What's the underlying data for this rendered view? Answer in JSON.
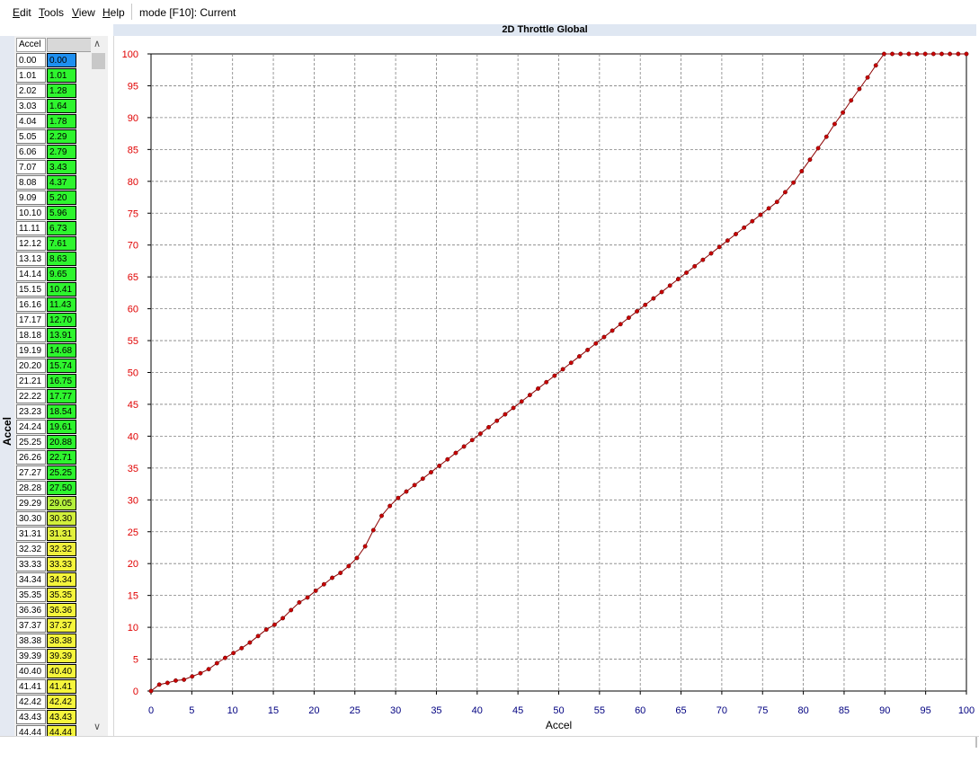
{
  "menu": {
    "items": [
      {
        "first": "E",
        "rest": "dit"
      },
      {
        "first": "T",
        "rest": "ools"
      },
      {
        "first": "V",
        "rest": "iew"
      },
      {
        "first": "H",
        "rest": "elp"
      }
    ],
    "mode_text": "mode [F10]: Current"
  },
  "side_label": "Accel",
  "table": {
    "header": "Accel",
    "rows": [
      {
        "k": "0.00",
        "v": "0.00",
        "color": "#1e8ff0"
      },
      {
        "k": "1.01",
        "v": "1.01",
        "color": "#2ef52e"
      },
      {
        "k": "2.02",
        "v": "1.28",
        "color": "#2ef52e"
      },
      {
        "k": "3.03",
        "v": "1.64",
        "color": "#2ef52e"
      },
      {
        "k": "4.04",
        "v": "1.78",
        "color": "#2ef52e"
      },
      {
        "k": "5.05",
        "v": "2.29",
        "color": "#2ef52e"
      },
      {
        "k": "6.06",
        "v": "2.79",
        "color": "#2ef52e"
      },
      {
        "k": "7.07",
        "v": "3.43",
        "color": "#2ef52e"
      },
      {
        "k": "8.08",
        "v": "4.37",
        "color": "#2ef52e"
      },
      {
        "k": "9.09",
        "v": "5.20",
        "color": "#2ef52e"
      },
      {
        "k": "10.10",
        "v": "5.96",
        "color": "#2ef52e"
      },
      {
        "k": "11.11",
        "v": "6.73",
        "color": "#2ef52e"
      },
      {
        "k": "12.12",
        "v": "7.61",
        "color": "#2ef52e"
      },
      {
        "k": "13.13",
        "v": "8.63",
        "color": "#2ef52e"
      },
      {
        "k": "14.14",
        "v": "9.65",
        "color": "#2ef52e"
      },
      {
        "k": "15.15",
        "v": "10.41",
        "color": "#2ef52e"
      },
      {
        "k": "16.16",
        "v": "11.43",
        "color": "#2ef52e"
      },
      {
        "k": "17.17",
        "v": "12.70",
        "color": "#2ef52e"
      },
      {
        "k": "18.18",
        "v": "13.91",
        "color": "#2ef52e"
      },
      {
        "k": "19.19",
        "v": "14.68",
        "color": "#2ef52e"
      },
      {
        "k": "20.20",
        "v": "15.74",
        "color": "#2ef52e"
      },
      {
        "k": "21.21",
        "v": "16.75",
        "color": "#2ef52e"
      },
      {
        "k": "22.22",
        "v": "17.77",
        "color": "#2ef52e"
      },
      {
        "k": "23.23",
        "v": "18.54",
        "color": "#2ef52e"
      },
      {
        "k": "24.24",
        "v": "19.61",
        "color": "#2ef52e"
      },
      {
        "k": "25.25",
        "v": "20.88",
        "color": "#2ef52e"
      },
      {
        "k": "26.26",
        "v": "22.71",
        "color": "#2ef52e"
      },
      {
        "k": "27.27",
        "v": "25.25",
        "color": "#2ef52e"
      },
      {
        "k": "28.28",
        "v": "27.50",
        "color": "#2ef52e"
      },
      {
        "k": "29.29",
        "v": "29.05",
        "color": "#b4f03c"
      },
      {
        "k": "30.30",
        "v": "30.30",
        "color": "#d2f03c"
      },
      {
        "k": "31.31",
        "v": "31.31",
        "color": "#e1f03c"
      },
      {
        "k": "32.32",
        "v": "32.32",
        "color": "#f0f03c"
      },
      {
        "k": "33.33",
        "v": "33.33",
        "color": "#f5f53c"
      },
      {
        "k": "34.34",
        "v": "34.34",
        "color": "#f5f53c"
      },
      {
        "k": "35.35",
        "v": "35.35",
        "color": "#f5f53c"
      },
      {
        "k": "36.36",
        "v": "36.36",
        "color": "#f5f53c"
      },
      {
        "k": "37.37",
        "v": "37.37",
        "color": "#f5f53c"
      },
      {
        "k": "38.38",
        "v": "38.38",
        "color": "#f5f53c"
      },
      {
        "k": "39.39",
        "v": "39.39",
        "color": "#f5f53c"
      },
      {
        "k": "40.40",
        "v": "40.40",
        "color": "#f5f53c"
      },
      {
        "k": "41.41",
        "v": "41.41",
        "color": "#f5f53c"
      },
      {
        "k": "42.42",
        "v": "42.42",
        "color": "#f5f53c"
      },
      {
        "k": "43.43",
        "v": "43.43",
        "color": "#f5f53c"
      },
      {
        "k": "44.44",
        "v": "44.44",
        "color": "#f5f53c"
      }
    ]
  },
  "chart_data": {
    "type": "line",
    "title": "2D Throttle Global",
    "xlabel": "Accel",
    "ylabel": "",
    "xlim": [
      0,
      100
    ],
    "ylim": [
      0,
      100
    ],
    "xticks": [
      0,
      5,
      10,
      15,
      20,
      25,
      30,
      35,
      40,
      45,
      50,
      55,
      60,
      65,
      70,
      75,
      80,
      85,
      90,
      95,
      100
    ],
    "yticks": [
      0,
      5,
      10,
      15,
      20,
      25,
      30,
      35,
      40,
      45,
      50,
      55,
      60,
      65,
      70,
      75,
      80,
      85,
      90,
      95,
      100
    ],
    "grid": true,
    "colors": {
      "line": "#8b0000",
      "marker": "#c80000",
      "ytick": "#e00000",
      "xtick": "#000080",
      "grid": "#808080"
    },
    "x": [
      0,
      1.01,
      2.02,
      3.03,
      4.04,
      5.05,
      6.06,
      7.07,
      8.08,
      9.09,
      10.1,
      11.11,
      12.12,
      13.13,
      14.14,
      15.15,
      16.16,
      17.17,
      18.18,
      19.19,
      20.2,
      21.21,
      22.22,
      23.23,
      24.24,
      25.25,
      26.26,
      27.27,
      28.28,
      29.29,
      30.3,
      31.31,
      32.32,
      33.33,
      34.34,
      35.35,
      36.36,
      37.37,
      38.38,
      39.39,
      40.4,
      41.41,
      42.42,
      43.43,
      44.44,
      45.45,
      46.46,
      47.47,
      48.48,
      49.49,
      50.51,
      51.52,
      52.53,
      53.54,
      54.55,
      55.56,
      56.57,
      57.58,
      58.59,
      59.6,
      60.61,
      61.62,
      62.63,
      63.64,
      64.65,
      65.66,
      66.67,
      67.68,
      68.69,
      69.7,
      70.71,
      71.72,
      72.73,
      73.74,
      74.75,
      75.76,
      76.77,
      77.78,
      78.79,
      79.8,
      80.81,
      81.82,
      82.83,
      83.84,
      84.85,
      85.86,
      86.87,
      87.88,
      88.89,
      89.9,
      90.91,
      91.92,
      92.93,
      93.94,
      94.95,
      95.96,
      96.97,
      97.98,
      98.99,
      100
    ],
    "y": [
      0,
      1.01,
      1.28,
      1.64,
      1.78,
      2.29,
      2.79,
      3.43,
      4.37,
      5.2,
      5.96,
      6.73,
      7.61,
      8.63,
      9.65,
      10.41,
      11.43,
      12.7,
      13.91,
      14.68,
      15.74,
      16.75,
      17.77,
      18.54,
      19.61,
      20.88,
      22.71,
      25.25,
      27.5,
      29.05,
      30.3,
      31.31,
      32.32,
      33.33,
      34.34,
      35.35,
      36.36,
      37.37,
      38.38,
      39.39,
      40.4,
      41.41,
      42.42,
      43.43,
      44.44,
      45.45,
      46.46,
      47.47,
      48.48,
      49.49,
      50.51,
      51.52,
      52.53,
      53.54,
      54.55,
      55.56,
      56.57,
      57.58,
      58.59,
      59.6,
      60.61,
      61.62,
      62.63,
      63.64,
      64.65,
      65.66,
      66.67,
      67.68,
      68.69,
      69.7,
      70.71,
      71.72,
      72.73,
      73.74,
      74.75,
      75.76,
      76.77,
      78.3,
      79.8,
      81.6,
      83.4,
      85.2,
      87.0,
      89.0,
      90.8,
      92.7,
      94.5,
      96.3,
      98.2,
      100,
      100,
      100,
      100,
      100,
      100,
      100,
      100,
      100,
      100,
      100
    ]
  }
}
